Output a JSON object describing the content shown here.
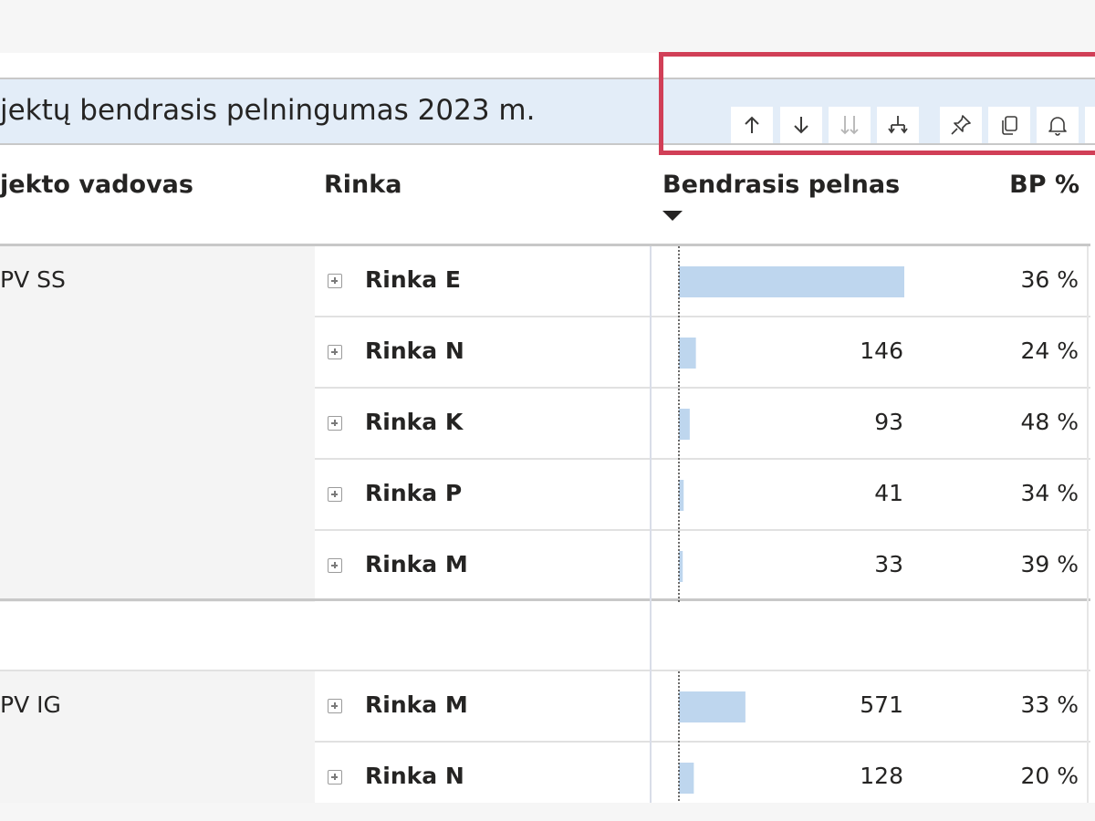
{
  "visual": {
    "title": "jektų bendrasis pelningumas 2023 m.",
    "toolbar": [
      {
        "name": "sort-up-icon"
      },
      {
        "name": "sort-down-icon"
      },
      {
        "name": "expand-all-down-icon"
      },
      {
        "name": "drill-hierarchy-icon"
      },
      {
        "name": "pin-icon"
      },
      {
        "name": "copy-icon"
      },
      {
        "name": "bell-icon"
      }
    ]
  },
  "table": {
    "columns": [
      "jekto vadovas",
      "Rinka",
      "Bendrasis pelnas",
      "BP %"
    ],
    "sorted_column": "Bendrasis pelnas",
    "groups": [
      {
        "label": "PV SS",
        "rows": [
          {
            "rinka": "Rinka E",
            "bp": "1.935",
            "value": 1935,
            "pct": "36 %"
          },
          {
            "rinka": "Rinka N",
            "bp": "146",
            "value": 146,
            "pct": "24 %"
          },
          {
            "rinka": "Rinka K",
            "bp": "93",
            "value": 93,
            "pct": "48 %"
          },
          {
            "rinka": "Rinka P",
            "bp": "41",
            "value": 41,
            "pct": "34 %"
          },
          {
            "rinka": "Rinka M",
            "bp": "33",
            "value": 33,
            "pct": "39 %"
          }
        ]
      },
      {
        "label": "PV IG",
        "rows": [
          {
            "rinka": "Rinka M",
            "bp": "571",
            "value": 571,
            "pct": "33 %"
          },
          {
            "rinka": "Rinka N",
            "bp": "128",
            "value": 128,
            "pct": "20 %"
          }
        ]
      }
    ]
  },
  "colors": {
    "bar": "#bed6ee",
    "highlight": "#d13f57",
    "title_bg": "#e3edf8"
  }
}
